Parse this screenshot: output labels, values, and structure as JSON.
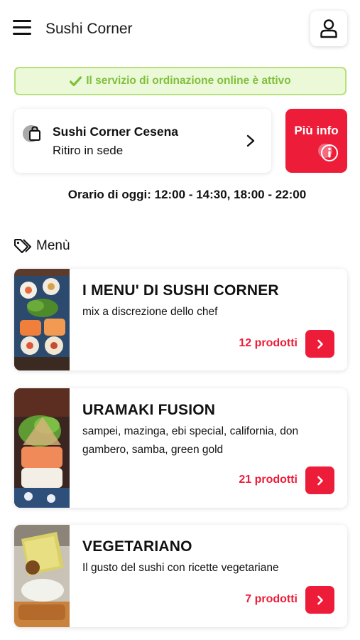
{
  "header": {
    "title": "Sushi Corner"
  },
  "banner": {
    "text": "Il servizio di ordinazione online è attivo",
    "color": "#7fbf3b"
  },
  "store": {
    "name": "Sushi Corner Cesena",
    "mode": "Ritiro in sede"
  },
  "info_button": {
    "label": "Più info"
  },
  "hours": {
    "text": "Orario di oggi: 12:00 - 14:30, 18:00 - 22:00"
  },
  "section": {
    "title": "Menù"
  },
  "categories": [
    {
      "title": "I MENU' DI SUSHI CORNER",
      "description": "mix a discrezione dello chef",
      "count": "12 prodotti"
    },
    {
      "title": "URAMAKI FUSION",
      "description": "sampei, mazinga, ebi special, california, don gambero, samba, green gold",
      "count": "21 prodotti"
    },
    {
      "title": "VEGETARIANO",
      "description": "Il gusto del sushi con ricette vegetariane",
      "count": "7 prodotti"
    }
  ],
  "colors": {
    "accent": "#ed1d3a",
    "banner_border": "#b6e07a",
    "banner_bg": "#ecf9d9"
  }
}
